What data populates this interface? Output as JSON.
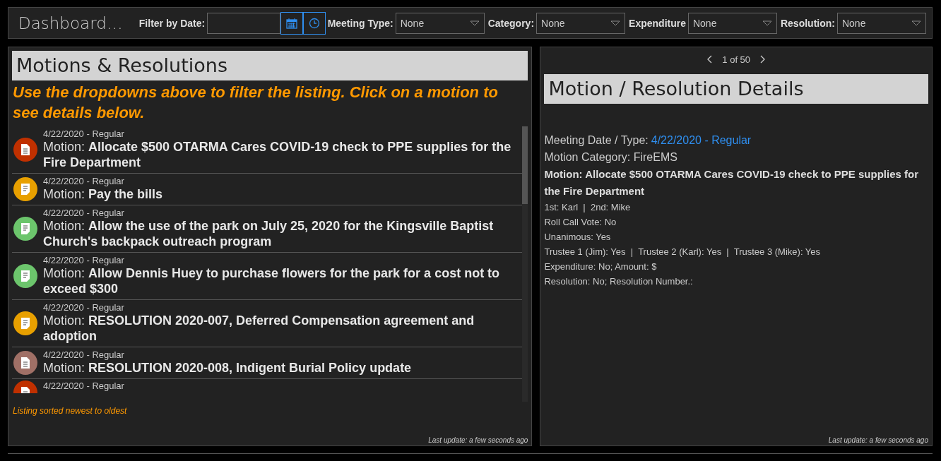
{
  "header": {
    "title": "Dashboard…",
    "filters": [
      {
        "kind": "date",
        "label": "Filter by Date:"
      },
      {
        "kind": "select",
        "label": "Meeting Type:",
        "value": "None"
      },
      {
        "kind": "select",
        "label": "Category:",
        "value": "None"
      },
      {
        "kind": "select",
        "label": "Expenditure",
        "value": "None"
      },
      {
        "kind": "select",
        "label": "Resolution:",
        "value": "None"
      }
    ]
  },
  "list_panel": {
    "title": "Motions & Resolutions",
    "instructions": "Use the dropdowns above to filter the listing. Click on a motion to see details below.",
    "items": [
      {
        "meta": "4/22/2020 - Regular",
        "motion": "Motion: **Allocate $500 OTARMA Cares COVID-19 check to PPE supplies for the Fire Department**",
        "color": "#c03000",
        "kind": "document"
      },
      {
        "meta": "4/22/2020 - Regular",
        "motion": "Motion: **Pay the bills**",
        "color": "#e8a000",
        "kind": "form"
      },
      {
        "meta": "4/22/2020 - Regular",
        "motion": "Motion: **Allow the use of the park on July 25, 2020 for the Kingsville Baptist Church's backpack outreach program**",
        "color": "#6cc56c",
        "kind": "form"
      },
      {
        "meta": "4/22/2020 - Regular",
        "motion": "Motion: **Allow Dennis Huey to purchase flowers for the park for a cost not to exceed $300**",
        "color": "#6cc56c",
        "kind": "form"
      },
      {
        "meta": "4/22/2020 - Regular",
        "motion": "Motion: **RESOLUTION 2020-007, Deferred Compensation agreement and adoption**",
        "color": "#e8a000",
        "kind": "form"
      },
      {
        "meta": "4/22/2020 - Regular",
        "motion": "Motion: **RESOLUTION 2020-008, Indigent Burial Policy update**",
        "color": "#a07066",
        "kind": "document"
      },
      {
        "meta": "4/22/2020 - Regular",
        "color": "#c03000",
        "kind": "document"
      }
    ],
    "footer": "Listing sorted newest to oldest",
    "last_update": "Last update: a few seconds ago"
  },
  "detail_panel": {
    "pager": "1 of 50",
    "title": "Motion / Resolution Details",
    "lines": [
      {
        "kind": "pair",
        "label": "Meeting Date / Type:",
        "value": "4/22/2020 - Regular"
      },
      {
        "kind": "large",
        "text": "Motion Category: FireEMS"
      },
      {
        "kind": "bold",
        "text": "Motion: Allocate $500 OTARMA Cares COVID-19 check to PPE supplies for the Fire Department"
      },
      {
        "kind": "small",
        "text": "1st: Karl  |  2nd: Mike"
      },
      {
        "kind": "small",
        "text": "Roll Call Vote: No"
      },
      {
        "kind": "small",
        "text": "Unanimous: Yes"
      },
      {
        "kind": "small",
        "text": "Trustee 1 (Jim): Yes  |  Trustee 2 (Karl): Yes  |  Trustee 3 (Mike): Yes"
      },
      {
        "kind": "small",
        "text": "Expenditure: No; Amount: $"
      },
      {
        "kind": "small",
        "text": "Resolution: No; Resolution Number.:"
      }
    ],
    "last_update": "Last update: a few seconds ago"
  }
}
